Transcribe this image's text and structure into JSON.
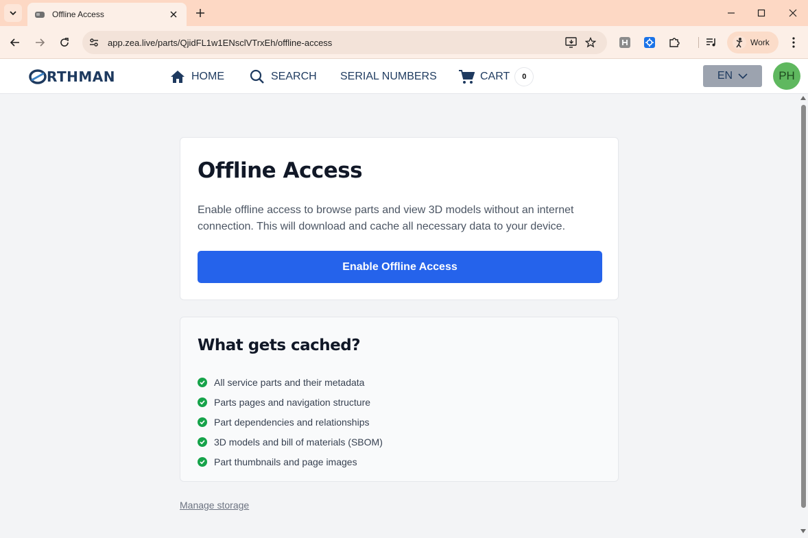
{
  "browser": {
    "tab_title": "Offline Access",
    "url": "app.zea.live/parts/QjidFL1w1ENsclVTrxEh/offline-access",
    "profile_label": "Work"
  },
  "header": {
    "logo": "RTHMAN",
    "nav": {
      "home": "HOME",
      "search": "SEARCH",
      "serial_numbers": "SERIAL NUMBERS",
      "cart": "CART",
      "cart_count": "0"
    },
    "language": "EN",
    "avatar_initials": "PH"
  },
  "offline": {
    "title": "Offline Access",
    "description": "Enable offline access to browse parts and view 3D models without an internet connection. This will download and cache all necessary data to your device.",
    "button_label": "Enable Offline Access"
  },
  "cache": {
    "title": "What gets cached?",
    "items": [
      "All service parts and their metadata",
      "Parts pages and navigation structure",
      "Part dependencies and relationships",
      "3D models and bill of materials (SBOM)",
      "Part thumbnails and page images"
    ]
  },
  "manage_storage": "Manage storage",
  "colors": {
    "primary": "#2563eb",
    "brand": "#1e3a5f",
    "success": "#16a34a",
    "avatar": "#5fb85f"
  }
}
